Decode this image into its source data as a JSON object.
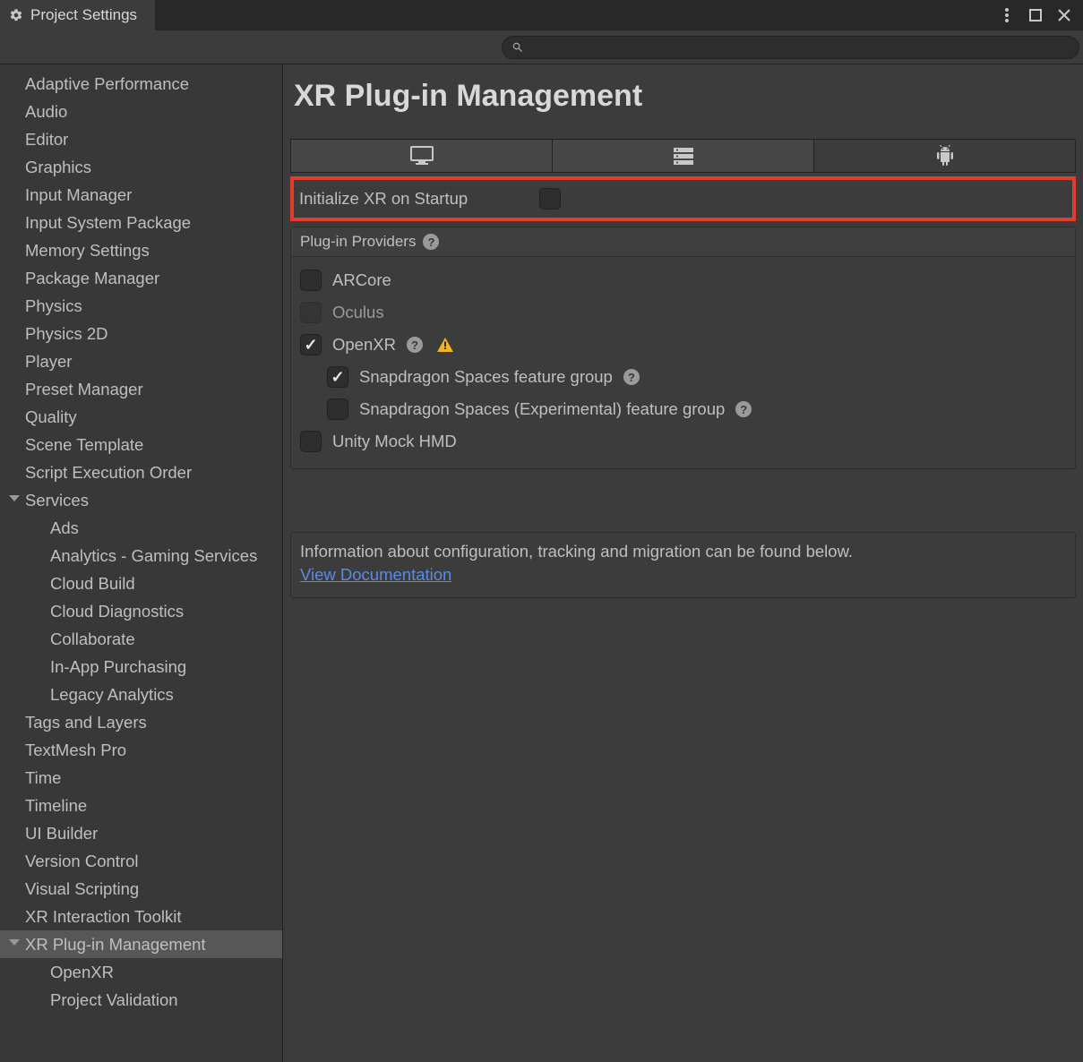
{
  "window": {
    "title": "Project Settings"
  },
  "search": {
    "placeholder": ""
  },
  "sidebar": {
    "items": [
      {
        "label": "Adaptive Performance"
      },
      {
        "label": "Audio"
      },
      {
        "label": "Editor"
      },
      {
        "label": "Graphics"
      },
      {
        "label": "Input Manager"
      },
      {
        "label": "Input System Package"
      },
      {
        "label": "Memory Settings"
      },
      {
        "label": "Package Manager"
      },
      {
        "label": "Physics"
      },
      {
        "label": "Physics 2D"
      },
      {
        "label": "Player"
      },
      {
        "label": "Preset Manager"
      },
      {
        "label": "Quality"
      },
      {
        "label": "Scene Template"
      },
      {
        "label": "Script Execution Order"
      },
      {
        "label": "Services",
        "expanded": true,
        "children": [
          {
            "label": "Ads"
          },
          {
            "label": "Analytics - Gaming Services"
          },
          {
            "label": "Cloud Build"
          },
          {
            "label": "Cloud Diagnostics"
          },
          {
            "label": "Collaborate"
          },
          {
            "label": "In-App Purchasing"
          },
          {
            "label": "Legacy Analytics"
          }
        ]
      },
      {
        "label": "Tags and Layers"
      },
      {
        "label": "TextMesh Pro"
      },
      {
        "label": "Time"
      },
      {
        "label": "Timeline"
      },
      {
        "label": "UI Builder"
      },
      {
        "label": "Version Control"
      },
      {
        "label": "Visual Scripting"
      },
      {
        "label": "XR Interaction Toolkit"
      },
      {
        "label": "XR Plug-in Management",
        "expanded": true,
        "selected": true,
        "children": [
          {
            "label": "OpenXR"
          },
          {
            "label": "Project Validation"
          }
        ]
      }
    ]
  },
  "page": {
    "title": "XR Plug-in Management",
    "platform_tabs": [
      {
        "icon": "desktop-icon",
        "active": false
      },
      {
        "icon": "server-icon",
        "active": false
      },
      {
        "icon": "android-icon",
        "active": true
      }
    ],
    "init_label": "Initialize XR on Startup",
    "init_checked": false,
    "providers_header": "Plug-in Providers",
    "providers": [
      {
        "label": "ARCore",
        "checked": false
      },
      {
        "label": "Oculus",
        "checked": false,
        "disabled": true
      },
      {
        "label": "OpenXR",
        "checked": true,
        "help": true,
        "warn": true,
        "children": [
          {
            "label": "Snapdragon Spaces feature group",
            "checked": true,
            "help": true
          },
          {
            "label": "Snapdragon Spaces (Experimental) feature group",
            "checked": false,
            "help": true
          }
        ]
      },
      {
        "label": "Unity Mock HMD",
        "checked": false
      }
    ],
    "info_text": "Information about configuration, tracking and migration can be found below.",
    "info_link": "View Documentation"
  }
}
